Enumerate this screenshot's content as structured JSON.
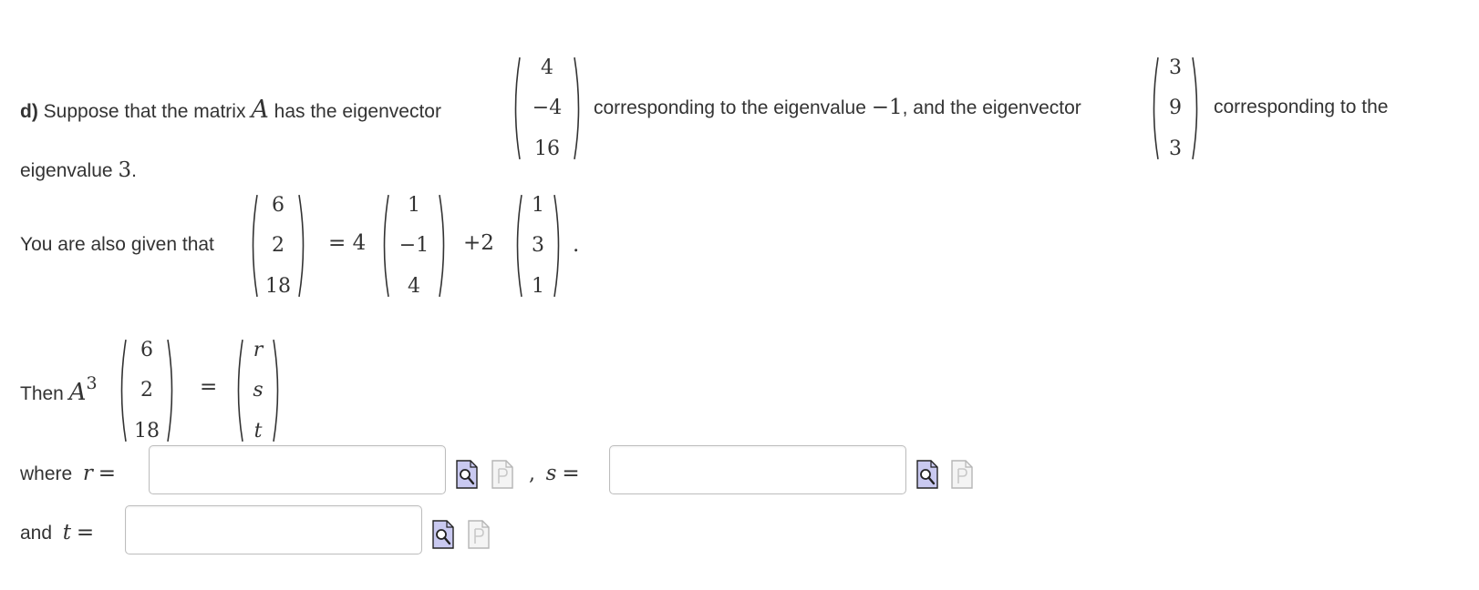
{
  "question": {
    "part_label": "d)",
    "line1_text_a": "Suppose that the matrix",
    "matrix_symbol": "A",
    "line1_text_b": "has the eigenvector",
    "eigenvector1": [
      "4",
      "−4",
      "16"
    ],
    "line1_text_c": "corresponding to the eigenvalue",
    "eigenvalue1": "−1",
    "line1_text_d": ", and the eigenvector",
    "eigenvector2": [
      "3",
      "9",
      "3"
    ],
    "line1_text_e": "corresponding to the",
    "line2_text_a": "eigenvalue",
    "eigenvalue2": "3",
    "line2_period": "."
  },
  "given": {
    "label": "You are also given that",
    "lhs_vector": [
      "6",
      "2",
      "18"
    ],
    "equals": "=",
    "coef1": "4",
    "vec1": [
      "1",
      "−1",
      "4"
    ],
    "plus": "+",
    "coef2": "2",
    "vec2": [
      "1",
      "3",
      "1"
    ],
    "period": "."
  },
  "then": {
    "label": "Then",
    "matrix_symbol": "A",
    "exponent": "3",
    "vector": [
      "6",
      "2",
      "18"
    ],
    "equals": "=",
    "result_vector": [
      "r",
      "s",
      "t"
    ]
  },
  "answers": {
    "where_label": "where",
    "r_var": "r",
    "s_var": "s",
    "t_var": "t",
    "equals": "=",
    "comma": ",",
    "and_label": "and",
    "r_value": "",
    "s_value": "",
    "t_value": ""
  },
  "icons": {
    "preview": "equation-preview-icon",
    "syntax": "syntax-help-icon"
  },
  "colors": {
    "text": "#333333",
    "input_border": "#bdbdbd",
    "preview_icon_fill": "#c9c9f0",
    "syntax_icon_stroke": "#b5b5b5"
  }
}
